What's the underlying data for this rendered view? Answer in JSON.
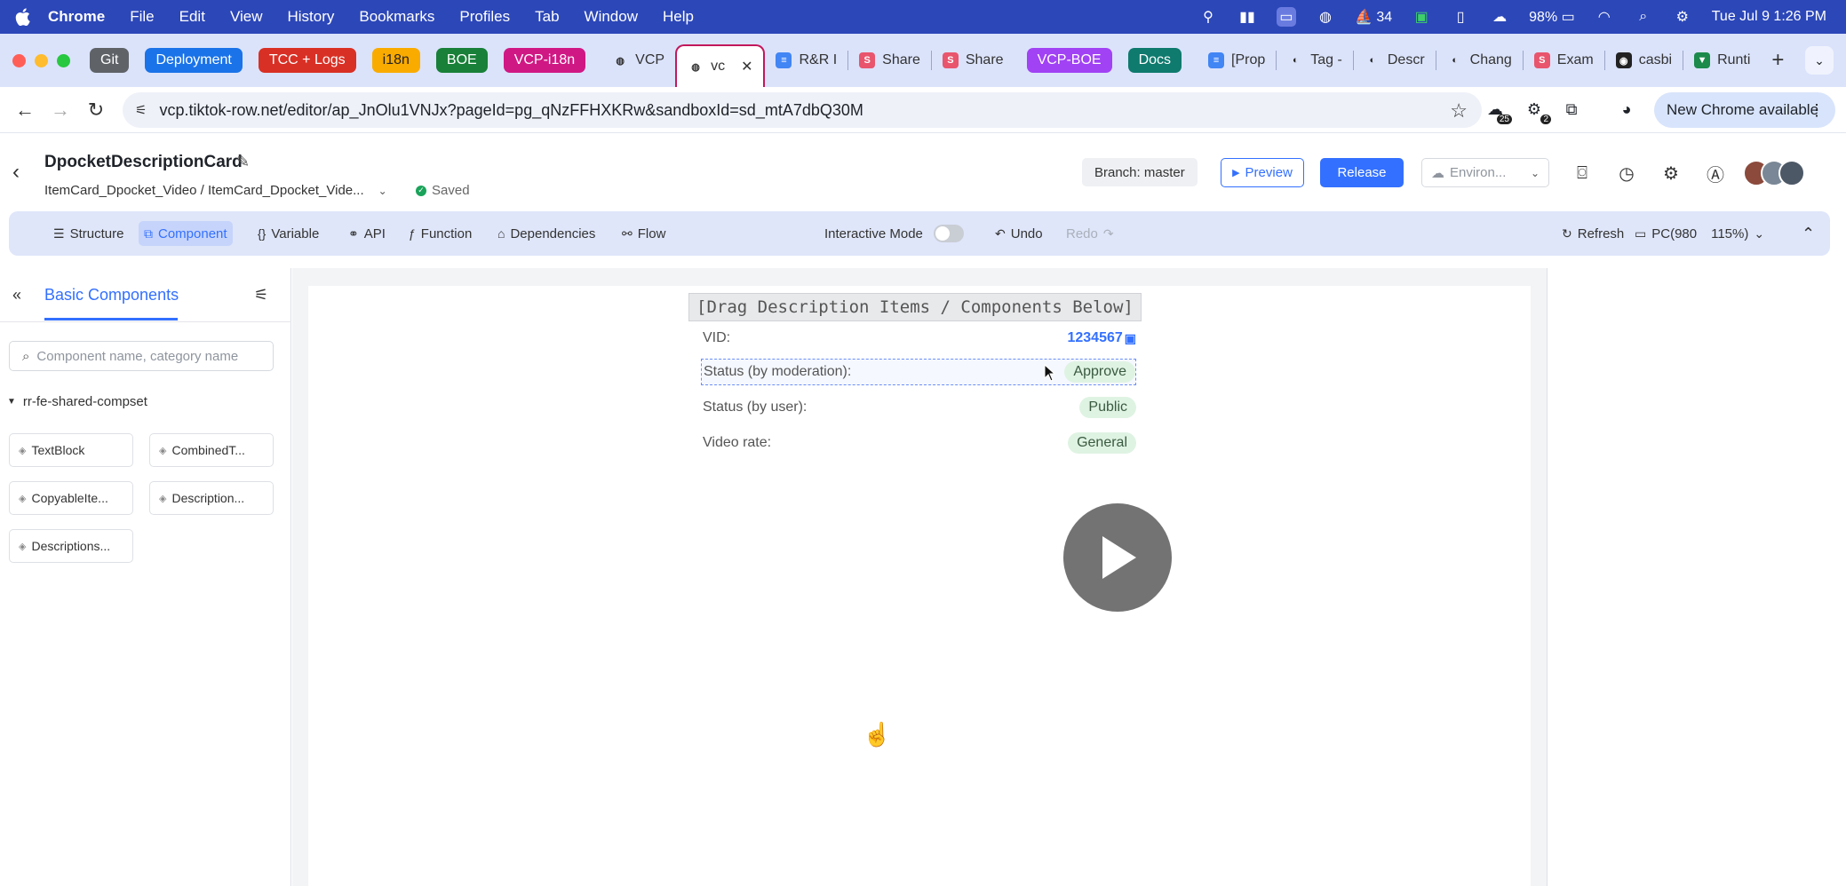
{
  "menubar": {
    "app": "Chrome",
    "menus": [
      "File",
      "Edit",
      "View",
      "History",
      "Bookmarks",
      "Profiles",
      "Tab",
      "Window",
      "Help"
    ],
    "status_badge_34": "34",
    "battery": "98%",
    "clock": "Tue Jul 9  1:26 PM"
  },
  "tabs": {
    "groups": [
      {
        "label": "Git",
        "color": "#5f6368"
      },
      {
        "label": "Deployment",
        "color": "#1a73e8"
      },
      {
        "label": "TCC + Logs",
        "color": "#d93025"
      },
      {
        "label": "i18n",
        "color": "#f9ab00"
      },
      {
        "label": "BOE",
        "color": "#188038"
      },
      {
        "label": "VCP-i18n",
        "color": "#d01884"
      }
    ],
    "vcp": "VCP",
    "active": "vc",
    "rest": [
      "R&R I",
      "Share",
      "Share"
    ],
    "groups2": [
      {
        "label": "VCP-BOE",
        "color": "#a142f4"
      },
      {
        "label": "Docs",
        "color": "#0f7a6e"
      }
    ],
    "rest2": [
      "[Prop",
      "Tag -",
      "Descr",
      "Chang",
      "Exam",
      "casbi",
      "Runti"
    ]
  },
  "toolbar": {
    "url": "vcp.tiktok-row.net/editor/ap_JnOlu1VNJx?pageId=pg_qNzFFHXKRw&sandboxId=sd_mtA7dbQ30M",
    "ext_badge_25": "25",
    "ext_badge_2": "2",
    "new_chrome": "New Chrome available"
  },
  "header": {
    "title": "DpocketDescriptionCard",
    "breadcrumb": "ItemCard_Dpocket_Video / ItemCard_Dpocket_Vide...",
    "saved": "Saved",
    "branch": "Branch: master",
    "preview": "Preview",
    "release": "Release",
    "environment": "Environ..."
  },
  "editor_bar": {
    "structure": "Structure",
    "component": "Component",
    "variable": "Variable",
    "api": "API",
    "function": "Function",
    "dependencies": "Dependencies",
    "flow": "Flow",
    "interactive_mode": "Interactive Mode",
    "undo": "Undo",
    "redo": "Redo",
    "refresh": "Refresh",
    "device": "PC(980",
    "zoom": "115%)"
  },
  "left_panel": {
    "title": "Basic Components",
    "search_placeholder": "Component name, category name",
    "group": "rr-fe-shared-compset",
    "components": [
      "TextBlock",
      "CombinedT...",
      "CopyableIte...",
      "Description...",
      "Descriptions..."
    ]
  },
  "canvas": {
    "drag_label": "[Drag Description Items / Components Below]",
    "rows": [
      {
        "label": "VID:",
        "value": "1234567"
      },
      {
        "label": "Status (by moderation):",
        "value": "Approve"
      },
      {
        "label": "Status (by user):",
        "value": "Public"
      },
      {
        "label": "Video rate:",
        "value": "General"
      }
    ]
  }
}
